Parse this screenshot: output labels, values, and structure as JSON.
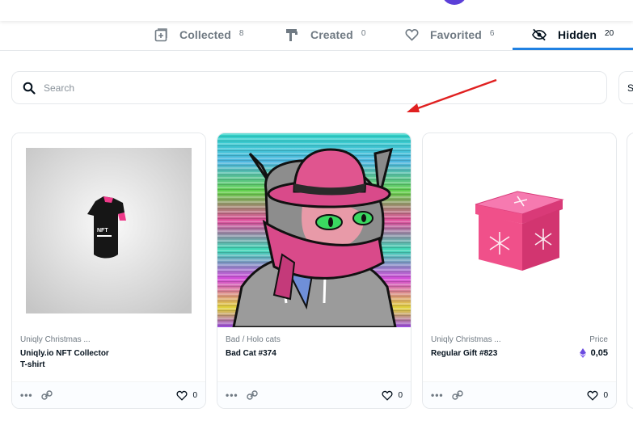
{
  "tabs": [
    {
      "label": "Collected",
      "count": "8",
      "icon": "collected-icon"
    },
    {
      "label": "Created",
      "count": "0",
      "icon": "created-icon"
    },
    {
      "label": "Favorited",
      "count": "6",
      "icon": "heart-icon"
    },
    {
      "label": "Hidden",
      "count": "20",
      "icon": "hidden-eye-icon",
      "active": true
    }
  ],
  "search": {
    "placeholder": "Search"
  },
  "sort": {
    "label": "S"
  },
  "cards": [
    {
      "collection": "Uniqly Christmas ...",
      "name_line1": "Uniqly.io NFT Collector",
      "name_line2": "T-shirt",
      "favorites": "0",
      "more": "•••"
    },
    {
      "collection": "Bad / Holo cats",
      "name_line1": "Bad Cat #374",
      "favorites": "0",
      "more": "•••"
    },
    {
      "collection": "Uniqly Christmas ...",
      "name_line1": "Regular Gift #823",
      "price_label": "Price",
      "price": "0,05",
      "currency": "eth-icon",
      "favorites": "0",
      "more": "•••"
    }
  ],
  "colors": {
    "accent": "#2081e2",
    "arrow": "#e02020",
    "gift": "#f0508a"
  }
}
